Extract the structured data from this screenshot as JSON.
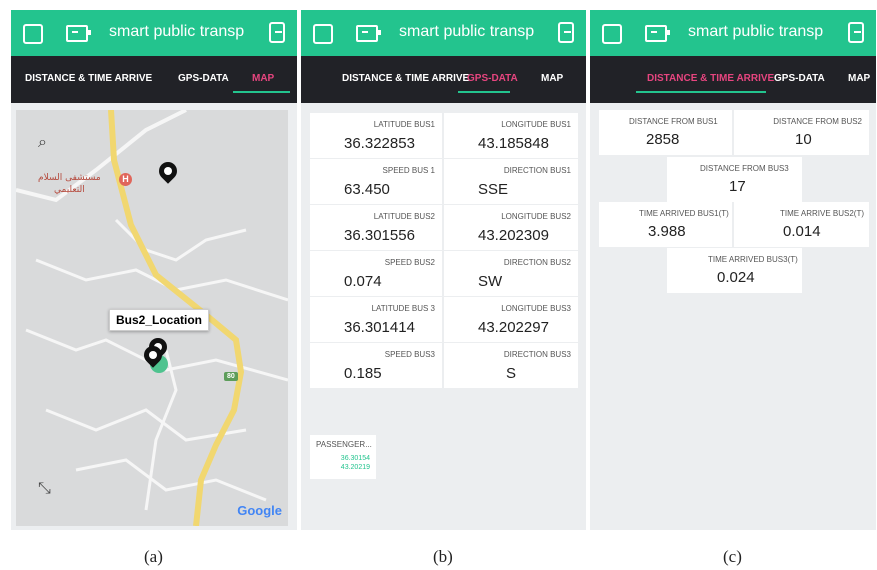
{
  "header": {
    "title": "smart public transp"
  },
  "tabs": {
    "distance": "DISTANCE & TIME ARRIVE",
    "gps": "GPS-DATA",
    "map": "MAP"
  },
  "map": {
    "marker_label": "Bus2_Location",
    "hospital_name": "مستشفى السلام",
    "hospital_sub": "التعليمي",
    "road_number": "80",
    "attribution": "Google",
    "hospital_letter": "H"
  },
  "gps": {
    "cards": [
      {
        "label": "LATITUDE BUS1",
        "value": "36.322853"
      },
      {
        "label": "LONGITUDE BUS1",
        "value": "43.185848"
      },
      {
        "label": "SPEED BUS 1",
        "value": "63.450"
      },
      {
        "label": "DIRECTION BUS1",
        "value": "SSE"
      },
      {
        "label": "LATITUDE BUS2",
        "value": "36.301556"
      },
      {
        "label": "LONGITUDE BUS2",
        "value": "43.202309"
      },
      {
        "label": "SPEED BUS2",
        "value": "0.074"
      },
      {
        "label": "DIRECTION BUS2",
        "value": "SW"
      },
      {
        "label": "LATITUDE BUS 3",
        "value": "36.301414"
      },
      {
        "label": "LONGITUDE BUS3",
        "value": "43.202297"
      },
      {
        "label": "SPEED BUS3",
        "value": "0.185"
      },
      {
        "label": "DIRECTION BUS3",
        "value": "S"
      }
    ],
    "passenger": {
      "label": "PASSENGER...",
      "lat": "36.30154",
      "lon": "43.20219"
    }
  },
  "distance": {
    "cards": [
      {
        "label": "DISTANCE FROM BUS1",
        "value": "2858"
      },
      {
        "label": "DISTANCE FROM BUS2",
        "value": "10"
      },
      {
        "label": "DISTANCE FROM BUS3",
        "value": "17"
      },
      {
        "label": "TIME ARRIVED BUS1(T)",
        "value": "3.988"
      },
      {
        "label": "TIME ARRIVE BUS2(T)",
        "value": "0.014"
      },
      {
        "label": "TIME ARRIVED BUS3(T)",
        "value": "0.024"
      }
    ]
  },
  "captions": {
    "a": "(a)",
    "b": "(b)",
    "c": "(c)"
  },
  "colors": {
    "accent": "#23c48e",
    "tab_bar": "#212227",
    "active_tab": "#e6457f"
  }
}
